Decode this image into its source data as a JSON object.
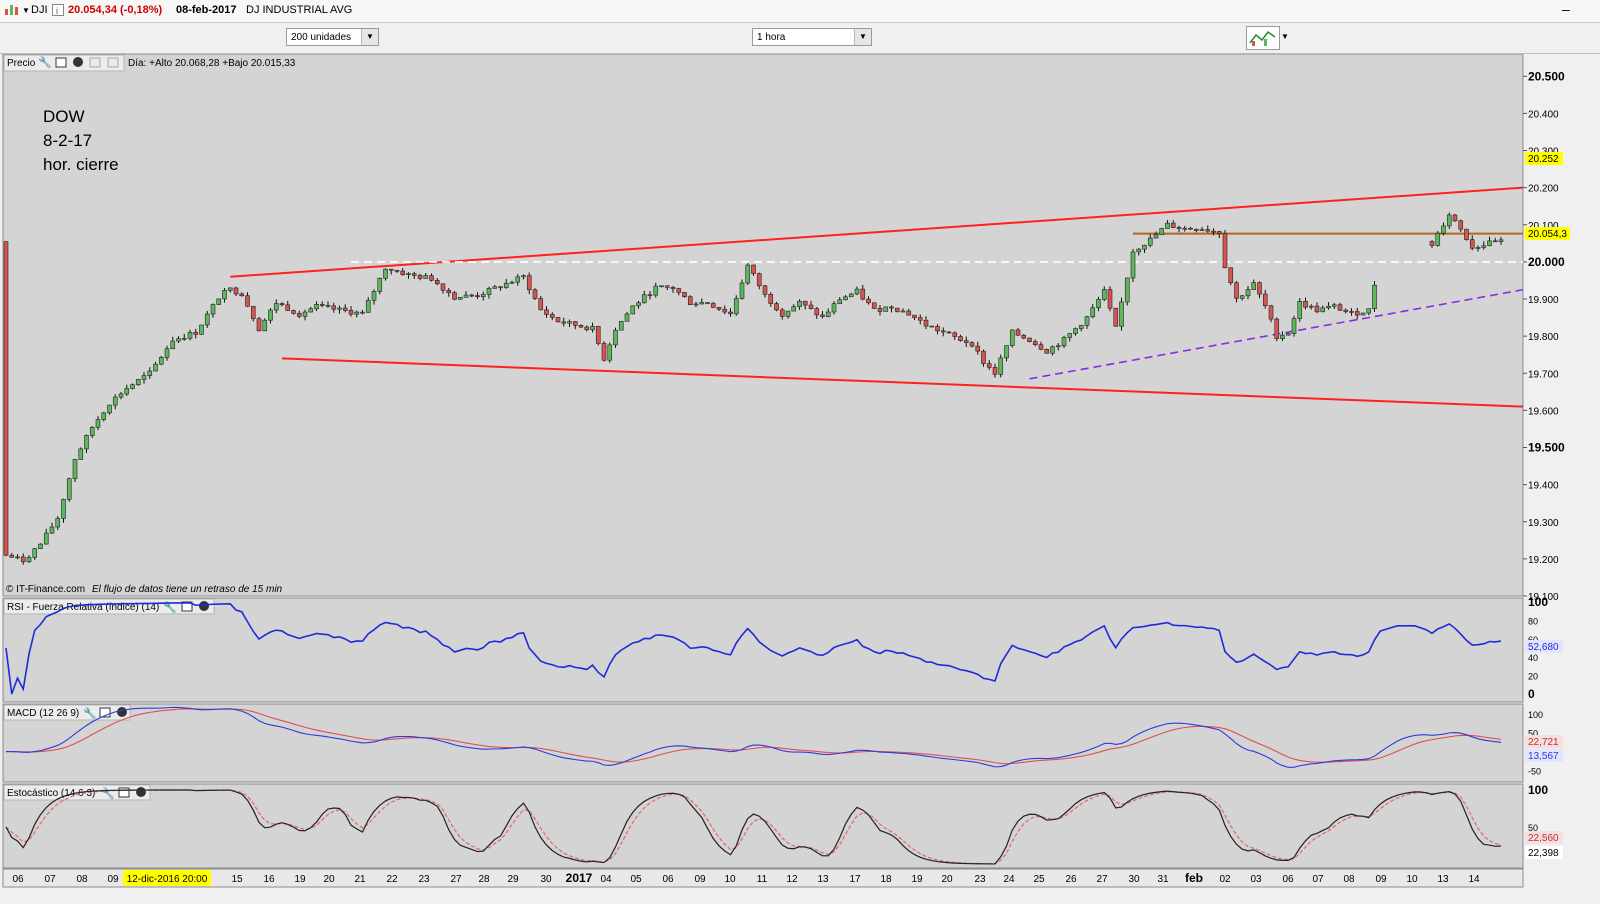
{
  "header": {
    "symbol": "DJI",
    "quote": "20.054,34 (-0,18%)",
    "date": "08-feb-2017",
    "name": "DJ INDUSTRIAL AVG"
  },
  "toolbar": {
    "units_value": "200 unidades",
    "interval_value": "1 hora"
  },
  "colors": {
    "panel_bg": "#d4d4d4",
    "up_candle": "#5cb85c",
    "down_candle": "#d9534f",
    "channel": "#ff2020",
    "support": "#8a2be2",
    "resistance": "#b5651d",
    "rsi": "#1f2bd9"
  },
  "price_panel": {
    "label": "Precio",
    "day_info": "Día: +Alto 20.068,28 +Bajo 20.015,33",
    "annotation": [
      "DOW",
      "8-2-17",
      "hor. cierre"
    ],
    "credit": "© IT-Finance.com",
    "delay_note": "El flujo de datos tiene un retraso de 15 min",
    "y_ticks": [
      "20.500",
      "20.400",
      "20.300",
      "20.200",
      "20.100",
      "20.000",
      "19.900",
      "19.800",
      "19.700",
      "19.600",
      "19.500",
      "19.400",
      "19.300",
      "19.200",
      "19.100"
    ],
    "marker_high": "20.252",
    "marker_last": "20.054,3"
  },
  "rsi_panel": {
    "label": "RSI - Fuerza Relativa (índice) (14)",
    "y_ticks": [
      "100",
      "80",
      "60",
      "40",
      "20",
      "0"
    ],
    "last": "52,680"
  },
  "macd_panel": {
    "label": "MACD (12 26 9)",
    "y_ticks": [
      "100",
      "50",
      "0",
      "-50"
    ],
    "signal": "22,721",
    "macd": "13,567"
  },
  "stoch_panel": {
    "label": "Estocástico (14 6 3)",
    "y_ticks": [
      "100",
      "50"
    ],
    "k": "22,560",
    "d": "22,398"
  },
  "x_axis": {
    "labels": [
      "06",
      "07",
      "08",
      "09",
      "12-dic-2016 20:00",
      "15",
      "16",
      "19",
      "20",
      "21",
      "22",
      "23",
      "27",
      "28",
      "29",
      "30",
      "2017",
      "04",
      "05",
      "06",
      "09",
      "10",
      "11",
      "12",
      "13",
      "17",
      "18",
      "19",
      "20",
      "23",
      "24",
      "25",
      "26",
      "27",
      "30",
      "31",
      "feb",
      "02",
      "03",
      "06",
      "07",
      "08",
      "09",
      "10",
      "13",
      "14"
    ]
  },
  "chart_data": {
    "type": "candlestick",
    "interval": "1 hora",
    "price_range": [
      19100,
      20560
    ],
    "anchors": [
      {
        "t": 0,
        "p": 19210
      },
      {
        "t": 3,
        "p": 19195
      },
      {
        "t": 6,
        "p": 19240
      },
      {
        "t": 9,
        "p": 19310
      },
      {
        "t": 12,
        "p": 19470
      },
      {
        "t": 15,
        "p": 19555
      },
      {
        "t": 18,
        "p": 19620
      },
      {
        "t": 21,
        "p": 19660
      },
      {
        "t": 25,
        "p": 19700
      },
      {
        "t": 29,
        "p": 19790
      },
      {
        "t": 33,
        "p": 19810
      },
      {
        "t": 36,
        "p": 19880
      },
      {
        "t": 38,
        "p": 19930
      },
      {
        "t": 41,
        "p": 19915
      },
      {
        "t": 44,
        "p": 19820
      },
      {
        "t": 47,
        "p": 19890
      },
      {
        "t": 51,
        "p": 19860
      },
      {
        "t": 54,
        "p": 19880
      },
      {
        "t": 58,
        "p": 19870
      },
      {
        "t": 62,
        "p": 19860
      },
      {
        "t": 66,
        "p": 19985
      },
      {
        "t": 70,
        "p": 19965
      },
      {
        "t": 74,
        "p": 19955
      },
      {
        "t": 78,
        "p": 19905
      },
      {
        "t": 82,
        "p": 19910
      },
      {
        "t": 86,
        "p": 19935
      },
      {
        "t": 90,
        "p": 19960
      },
      {
        "t": 93,
        "p": 19870
      },
      {
        "t": 96,
        "p": 19840
      },
      {
        "t": 99,
        "p": 19830
      },
      {
        "t": 102,
        "p": 19820
      },
      {
        "t": 104,
        "p": 19740
      },
      {
        "t": 106,
        "p": 19820
      },
      {
        "t": 109,
        "p": 19880
      },
      {
        "t": 113,
        "p": 19930
      },
      {
        "t": 116,
        "p": 19930
      },
      {
        "t": 119,
        "p": 19890
      },
      {
        "t": 122,
        "p": 19890
      },
      {
        "t": 126,
        "p": 19860
      },
      {
        "t": 129,
        "p": 19990
      },
      {
        "t": 132,
        "p": 19910
      },
      {
        "t": 135,
        "p": 19860
      },
      {
        "t": 138,
        "p": 19890
      },
      {
        "t": 142,
        "p": 19850
      },
      {
        "t": 145,
        "p": 19900
      },
      {
        "t": 148,
        "p": 19920
      },
      {
        "t": 151,
        "p": 19870
      },
      {
        "t": 154,
        "p": 19880
      },
      {
        "t": 157,
        "p": 19860
      },
      {
        "t": 160,
        "p": 19830
      },
      {
        "t": 163,
        "p": 19810
      },
      {
        "t": 166,
        "p": 19790
      },
      {
        "t": 168,
        "p": 19780
      },
      {
        "t": 170,
        "p": 19730
      },
      {
        "t": 172,
        "p": 19700
      },
      {
        "t": 175,
        "p": 19810
      },
      {
        "t": 178,
        "p": 19790
      },
      {
        "t": 181,
        "p": 19760
      },
      {
        "t": 184,
        "p": 19790
      },
      {
        "t": 188,
        "p": 19850
      },
      {
        "t": 191,
        "p": 19920
      },
      {
        "t": 193,
        "p": 19820
      },
      {
        "t": 196,
        "p": 20030
      },
      {
        "t": 199,
        "p": 20060
      },
      {
        "t": 202,
        "p": 20100
      },
      {
        "t": 205,
        "p": 20090
      },
      {
        "t": 208,
        "p": 20090
      },
      {
        "t": 211,
        "p": 20080
      },
      {
        "t": 212,
        "p": 19990
      },
      {
        "t": 214,
        "p": 19900
      },
      {
        "t": 217,
        "p": 19940
      },
      {
        "t": 219,
        "p": 19880
      },
      {
        "t": 221,
        "p": 19800
      },
      {
        "t": 223,
        "p": 19810
      },
      {
        "t": 225,
        "p": 19890
      },
      {
        "t": 228,
        "p": 19870
      },
      {
        "t": 231,
        "p": 19880
      },
      {
        "t": 234,
        "p": 19860
      },
      {
        "t": 237,
        "p": 19870
      },
      {
        "t": 239,
        "p": 20010
      },
      {
        "t": 242,
        "p": 20070
      },
      {
        "t": 245,
        "p": 20070
      },
      {
        "t": 248,
        "p": 20050
      },
      {
        "t": 251,
        "p": 20130
      },
      {
        "t": 253,
        "p": 20090
      },
      {
        "t": 255,
        "p": 20040
      },
      {
        "t": 258,
        "p": 20050
      },
      {
        "t": 260,
        "p": 20054
      }
    ],
    "drawn_lines": [
      {
        "name": "upper-channel",
        "color": "#ff2020",
        "from": {
          "t": 39,
          "p": 19960
        },
        "to": {
          "t": 300,
          "p": 20200
        }
      },
      {
        "name": "lower-channel",
        "color": "#ff2020",
        "from": {
          "t": 48,
          "p": 19740
        },
        "to": {
          "t": 300,
          "p": 19610
        }
      },
      {
        "name": "support",
        "color": "#8a2be2",
        "style": "dashed",
        "from": {
          "t": 178,
          "p": 19685
        },
        "to": {
          "t": 292,
          "p": 19925
        }
      },
      {
        "name": "resistance",
        "color": "#b5651d",
        "from": {
          "t": 196,
          "p": 20076
        },
        "to": {
          "t": 300,
          "p": 20076
        }
      },
      {
        "name": "level-20000",
        "color": "#ffffff",
        "style": "dashed",
        "from": {
          "t": 60,
          "p": 20000
        },
        "to": {
          "t": 300,
          "p": 20000
        }
      }
    ]
  }
}
